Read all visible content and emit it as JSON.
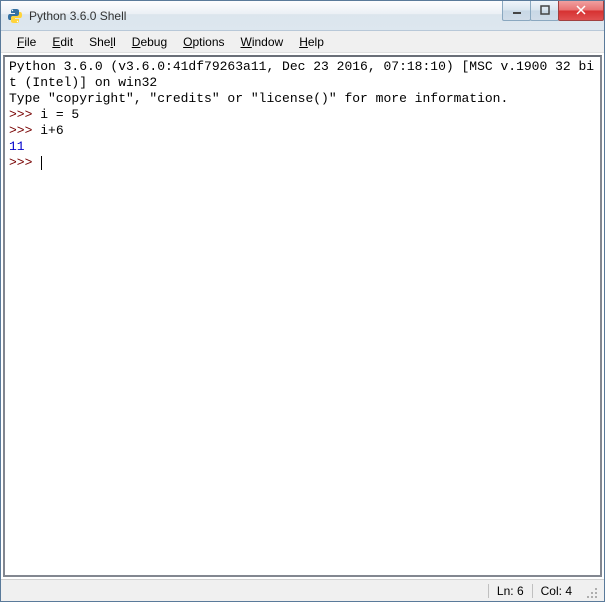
{
  "window": {
    "title": "Python 3.6.0 Shell"
  },
  "menu": {
    "file": "File",
    "edit": "Edit",
    "shell": "Shell",
    "debug": "Debug",
    "options": "Options",
    "window": "Window",
    "help": "Help"
  },
  "shell": {
    "banner1": "Python 3.6.0 (v3.6.0:41df79263a11, Dec 23 2016, 07:18:10) [MSC v.1900 32 bit (Intel)] on win32",
    "banner2": "Type \"copyright\", \"credits\" or \"license()\" for more information.",
    "prompt": ">>> ",
    "lines": [
      {
        "input": "i = 5",
        "output": null
      },
      {
        "input": "i+6",
        "output": "11"
      }
    ]
  },
  "status": {
    "line_label": "Ln: ",
    "line": "6",
    "col_label": "Col: ",
    "col": "4"
  }
}
